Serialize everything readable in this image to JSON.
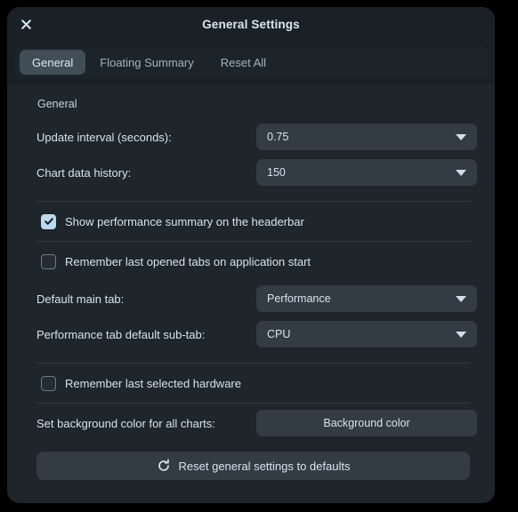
{
  "window": {
    "title": "General Settings",
    "close_icon": "close-icon"
  },
  "tabs": [
    {
      "label": "General",
      "active": true
    },
    {
      "label": "Floating Summary",
      "active": false
    },
    {
      "label": "Reset All",
      "active": false
    }
  ],
  "content": {
    "section_title": "General",
    "rows": {
      "update_interval": {
        "label": "Update interval (seconds):",
        "value": "0.75"
      },
      "chart_history": {
        "label": "Chart data history:",
        "value": "150"
      },
      "show_summary": {
        "label": "Show performance summary on the headerbar",
        "checked": "true"
      },
      "remember_tabs": {
        "label": "Remember last opened tabs on application start",
        "checked": "false"
      },
      "default_main_tab": {
        "label": "Default main tab:",
        "value": "Performance"
      },
      "default_sub_tab": {
        "label": "Performance tab default sub-tab:",
        "value": "CPU"
      },
      "remember_hardware": {
        "label": "Remember last selected hardware",
        "checked": "false"
      },
      "background_color": {
        "label": "Set background color for all charts:",
        "button_label": "Background color"
      }
    },
    "reset_button": {
      "label": "Reset general settings to defaults",
      "icon": "refresh-icon"
    }
  },
  "colors": {
    "page_background": "#000000",
    "dialog_background": "#1e252b",
    "titlebar_background": "#1a2026",
    "control_background": "#333b44",
    "active_tab_background": "#414e58",
    "text_primary": "#d5e4ef",
    "text_muted": "#9fb3c2",
    "checkbox_on": "#bcd9ee",
    "divider": "#323a40"
  }
}
